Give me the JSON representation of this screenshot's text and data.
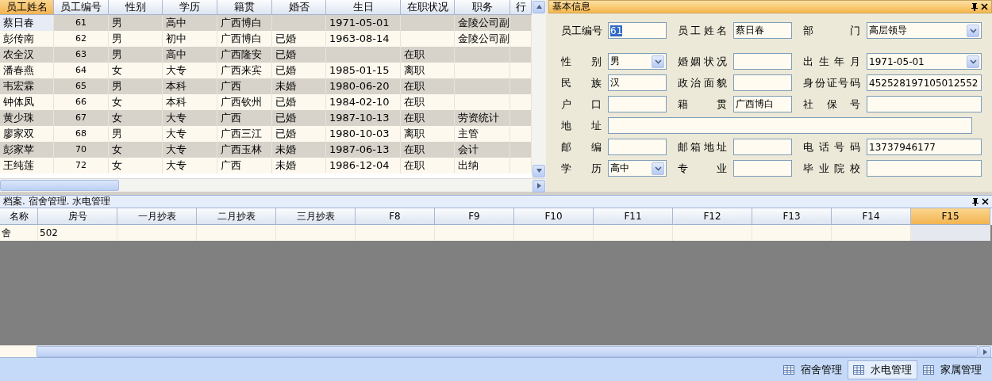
{
  "employee_grid": {
    "columns": [
      {
        "label": "员工姓名",
        "selected": true
      },
      {
        "label": "员工编号",
        "selected": false
      },
      {
        "label": "性别",
        "selected": false
      },
      {
        "label": "学历",
        "selected": false
      },
      {
        "label": "籍贯",
        "selected": false
      },
      {
        "label": "婚否",
        "selected": false
      },
      {
        "label": "生日",
        "selected": false
      },
      {
        "label": "在职状况",
        "selected": false
      },
      {
        "label": "职务",
        "selected": false
      },
      {
        "label": "行",
        "selected": false
      }
    ],
    "rows": [
      {
        "selected": true,
        "cells": [
          "蔡日春",
          "61",
          "男",
          "高中",
          "广西博白",
          "",
          "1971-05-01",
          "",
          "金陵公司副",
          ""
        ]
      },
      {
        "selected": false,
        "cells": [
          "彭传南",
          "62",
          "男",
          "初中",
          "广西博白",
          "已婚",
          "1963-08-14",
          "",
          "金陵公司副",
          ""
        ]
      },
      {
        "selected": false,
        "cells": [
          "农全汉",
          "63",
          "男",
          "高中",
          "广西隆安",
          "已婚",
          "",
          "在职",
          "",
          ""
        ]
      },
      {
        "selected": false,
        "cells": [
          "潘春燕",
          "64",
          "女",
          "大专",
          "广西来宾",
          "已婚",
          "1985-01-15",
          "离职",
          "",
          ""
        ]
      },
      {
        "selected": false,
        "cells": [
          "韦宏霖",
          "65",
          "男",
          "本科",
          "广西",
          "未婚",
          "1980-06-20",
          "在职",
          "",
          ""
        ]
      },
      {
        "selected": false,
        "cells": [
          "钟体凤",
          "66",
          "女",
          "本科",
          "广西钦州",
          "已婚",
          "1984-02-10",
          "在职",
          "",
          ""
        ]
      },
      {
        "selected": false,
        "cells": [
          "黄少珠",
          "67",
          "女",
          "大专",
          "广西",
          "已婚",
          "1987-10-13",
          "在职",
          "劳资统计",
          ""
        ]
      },
      {
        "selected": false,
        "cells": [
          "廖家双",
          "68",
          "男",
          "大专",
          "广西三江",
          "已婚",
          "1980-10-03",
          "离职",
          "主管",
          ""
        ]
      },
      {
        "selected": false,
        "cells": [
          "彭家苹",
          "70",
          "女",
          "大专",
          "广西玉林",
          "未婚",
          "1987-06-13",
          "在职",
          "会计",
          ""
        ]
      },
      {
        "selected": false,
        "cells": [
          "王纯莲",
          "72",
          "女",
          "大专",
          "广西",
          "未婚",
          "1986-12-04",
          "在职",
          "出纳",
          ""
        ]
      }
    ]
  },
  "info_panel": {
    "title": "基本信息",
    "rows": [
      {
        "kind": "triple",
        "fields": [
          {
            "label": "员工编号",
            "value": "61",
            "kind": "text",
            "highlighted": true
          },
          {
            "label": "员工姓名",
            "value": "蔡日春",
            "kind": "text",
            "highlighted": false
          },
          {
            "label": "部 门",
            "value": "高层领导",
            "kind": "select",
            "highlighted": false
          }
        ]
      },
      {
        "kind": "triple",
        "fields": [
          {
            "label": "性 别",
            "value": "男",
            "kind": "select",
            "highlighted": false
          },
          {
            "label": "婚姻状况",
            "kind": "text"
          },
          {
            "label": "出生年月",
            "value": "1971-05-01",
            "kind": "select",
            "highlighted": false
          }
        ]
      },
      {
        "kind": "triple",
        "fields": [
          {
            "label": "民 族",
            "value": "汉",
            "kind": "text",
            "highlighted": false
          },
          {
            "label": "政治面貌",
            "kind": "text"
          },
          {
            "label": "身份证号码",
            "value": "452528197105012552",
            "kind": "text",
            "highlighted": false
          }
        ]
      },
      {
        "kind": "triple",
        "fields": [
          {
            "label": "户 口",
            "kind": "text"
          },
          {
            "label": "籍 贯",
            "value": "广西博白",
            "kind": "text",
            "highlighted": false
          },
          {
            "label": "社保号",
            "kind": "text"
          }
        ]
      },
      {
        "kind": "wide",
        "fields": [
          {
            "label": "地 址",
            "kind": "text"
          }
        ]
      },
      {
        "kind": "triple",
        "fields": [
          {
            "label": "邮 编",
            "kind": "text"
          },
          {
            "label": "邮箱地址",
            "kind": "text"
          },
          {
            "label": "电话号码",
            "value": "13737946177",
            "kind": "text",
            "highlighted": false
          }
        ]
      },
      {
        "kind": "triple",
        "fields": [
          {
            "label": "学 历",
            "value": "高中",
            "kind": "select",
            "highlighted": false
          },
          {
            "label": "专 业",
            "kind": "text"
          },
          {
            "label": "毕业院校",
            "kind": "text"
          }
        ]
      }
    ]
  },
  "bottom_panel": {
    "title": "档案. 宿舍管理. 水电管理",
    "columns": [
      {
        "label": "名称",
        "selected": false
      },
      {
        "label": "房号",
        "selected": false
      },
      {
        "label": "一月抄表",
        "selected": false
      },
      {
        "label": "二月抄表",
        "selected": false
      },
      {
        "label": "三月抄表",
        "selected": false
      },
      {
        "label": "F8",
        "selected": false
      },
      {
        "label": "F9",
        "selected": false
      },
      {
        "label": "F10",
        "selected": false
      },
      {
        "label": "F11",
        "selected": false
      },
      {
        "label": "F12",
        "selected": false
      },
      {
        "label": "F13",
        "selected": false
      },
      {
        "label": "F14",
        "selected": false
      },
      {
        "label": "F15",
        "selected": true
      }
    ],
    "rows": [
      {
        "cells": [
          "舍",
          "502",
          "",
          "",
          "",
          "",
          "",
          "",
          "",
          "",
          "",
          "",
          ""
        ]
      }
    ]
  },
  "status_tabs": [
    {
      "label": "宿舍管理",
      "selected": false
    },
    {
      "label": "水电管理",
      "selected": true
    },
    {
      "label": "家属管理",
      "selected": false
    }
  ]
}
